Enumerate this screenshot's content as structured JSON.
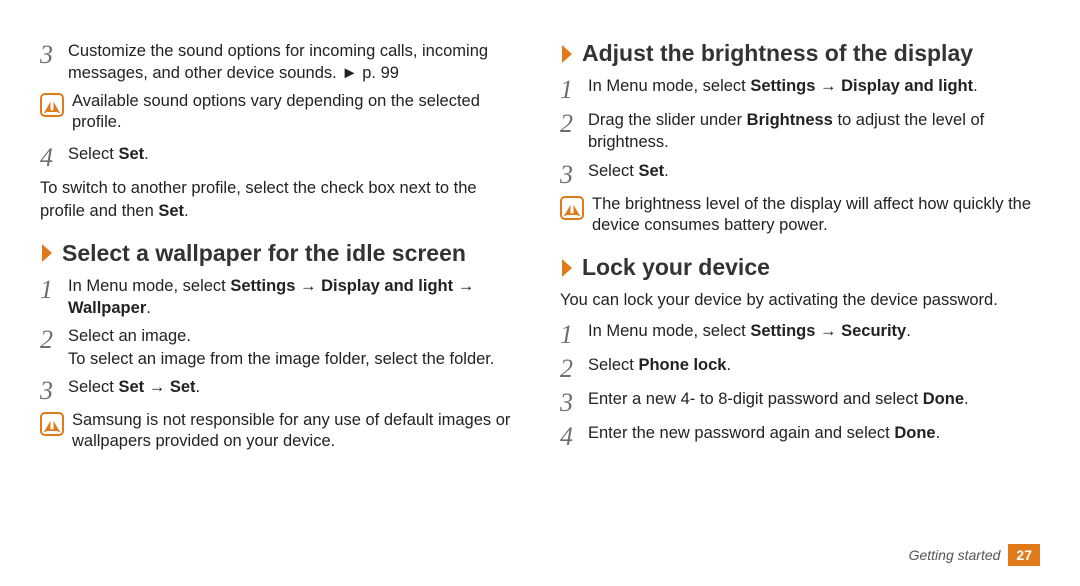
{
  "left": {
    "step3_num": "3",
    "step3_a": "Customize the sound options for incoming calls, incoming messages, and other device sounds. ",
    "step3_b": "► p. 99",
    "note1": "Available sound options vary depending on the selected profile.",
    "step4_num": "4",
    "step4_a": "Select ",
    "step4_b": "Set",
    "step4_c": ".",
    "para1_a": "To switch to another profile, select the check box next to the profile and then ",
    "para1_b": "Set",
    "para1_c": ".",
    "sec1_title": "Select a wallpaper for the idle screen",
    "s1_1_num": "1",
    "s1_1_a": "In Menu mode, select ",
    "s1_1_b": "Settings",
    "s1_1_c": " → ",
    "s1_1_d": "Display and light",
    "s1_1_e": " → ",
    "s1_1_f": "Wallpaper",
    "s1_1_g": ".",
    "s1_2_num": "2",
    "s1_2_a": "Select an image.",
    "s1_2_b": "To select an image from the image folder, select the folder.",
    "s1_3_num": "3",
    "s1_3_a": "Select ",
    "s1_3_b": "Set",
    "s1_3_c": " → ",
    "s1_3_d": "Set",
    "s1_3_e": ".",
    "note2": "Samsung is not responsible for any use of default images or wallpapers provided on your device."
  },
  "right": {
    "sec2_title": "Adjust the brightness of the display",
    "s2_1_num": "1",
    "s2_1_a": "In Menu mode, select ",
    "s2_1_b": "Settings",
    "s2_1_c": " → ",
    "s2_1_d": "Display and light",
    "s2_1_e": ".",
    "s2_2_num": "2",
    "s2_2_a": "Drag the slider under ",
    "s2_2_b": "Brightness",
    "s2_2_c": " to adjust the level of brightness.",
    "s2_3_num": "3",
    "s2_3_a": "Select ",
    "s2_3_b": "Set",
    "s2_3_c": ".",
    "note3": "The brightness level of the display will affect how quickly the device consumes battery power.",
    "sec3_title": "Lock your device",
    "sec3_intro": "You can lock your device by activating the device password.",
    "s3_1_num": "1",
    "s3_1_a": "In Menu mode, select ",
    "s3_1_b": "Settings",
    "s3_1_c": " → ",
    "s3_1_d": "Security",
    "s3_1_e": ".",
    "s3_2_num": "2",
    "s3_2_a": "Select ",
    "s3_2_b": "Phone lock",
    "s3_2_c": ".",
    "s3_3_num": "3",
    "s3_3_a": "Enter a new 4- to 8-digit password and select ",
    "s3_3_b": "Done",
    "s3_3_c": ".",
    "s3_4_num": "4",
    "s3_4_a": "Enter the new password again and select ",
    "s3_4_b": "Done",
    "s3_4_c": "."
  },
  "footer": {
    "label": "Getting started",
    "page": "27"
  }
}
